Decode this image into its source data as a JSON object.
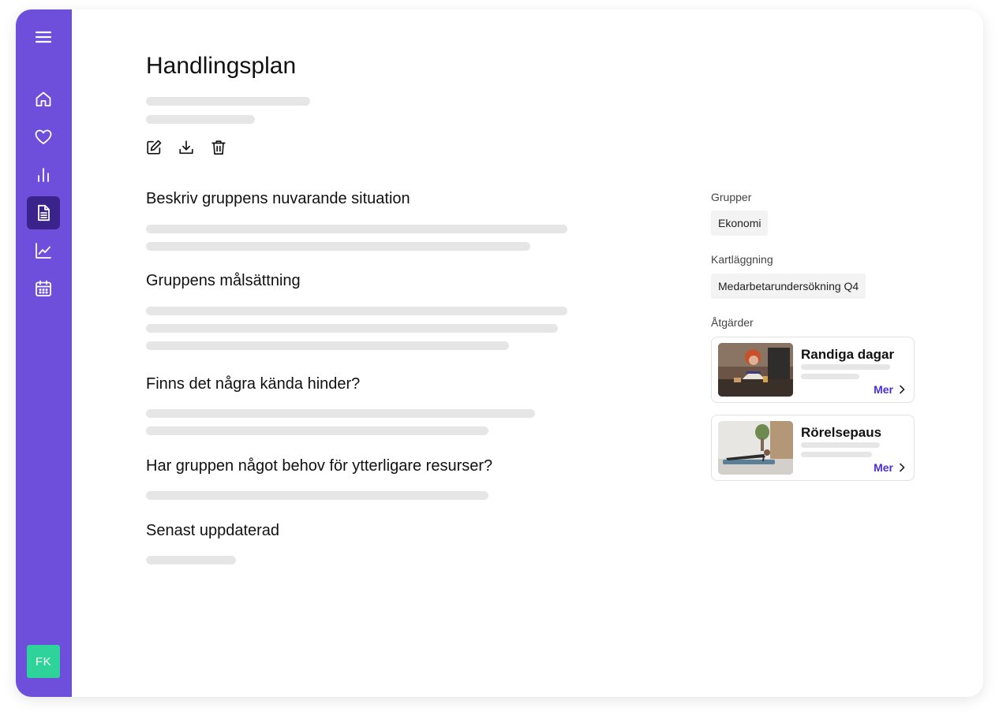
{
  "colors": {
    "sidebar": "#6e4fdc",
    "sidebar_active": "#3b238c",
    "avatar": "#2ed39a",
    "link": "#4b2ed1",
    "skeleton": "#e6e6e6"
  },
  "sidebar": {
    "menu_icon": "hamburger-menu-icon",
    "items": [
      {
        "icon": "home-icon",
        "active": false
      },
      {
        "icon": "heart-icon",
        "active": false
      },
      {
        "icon": "bar-chart-icon",
        "active": false
      },
      {
        "icon": "document-icon",
        "active": true
      },
      {
        "icon": "line-chart-icon",
        "active": false
      },
      {
        "icon": "calendar-icon",
        "active": false
      }
    ],
    "avatar_initials": "FK"
  },
  "page": {
    "title": "Handlingsplan",
    "toolbar": [
      "edit-icon",
      "download-icon",
      "trash-icon"
    ]
  },
  "sections": [
    {
      "heading": "Beskriv gruppens nuvarande situation"
    },
    {
      "heading": "Gruppens målsättning"
    },
    {
      "heading": "Finns det några kända hinder?"
    },
    {
      "heading": "Har gruppen något behov för ytterligare resurser?"
    },
    {
      "heading": "Senast uppdaterad"
    }
  ],
  "side": {
    "groups_label": "Grupper",
    "group": "Ekonomi",
    "survey_label": "Kartläggning",
    "survey": "Medarbetarundersökning Q4",
    "actions_label": "Åtgärder",
    "actions": [
      {
        "title": "Randiga dagar",
        "more": "Mer"
      },
      {
        "title": "Rörelsepaus",
        "more": "Mer"
      }
    ]
  }
}
